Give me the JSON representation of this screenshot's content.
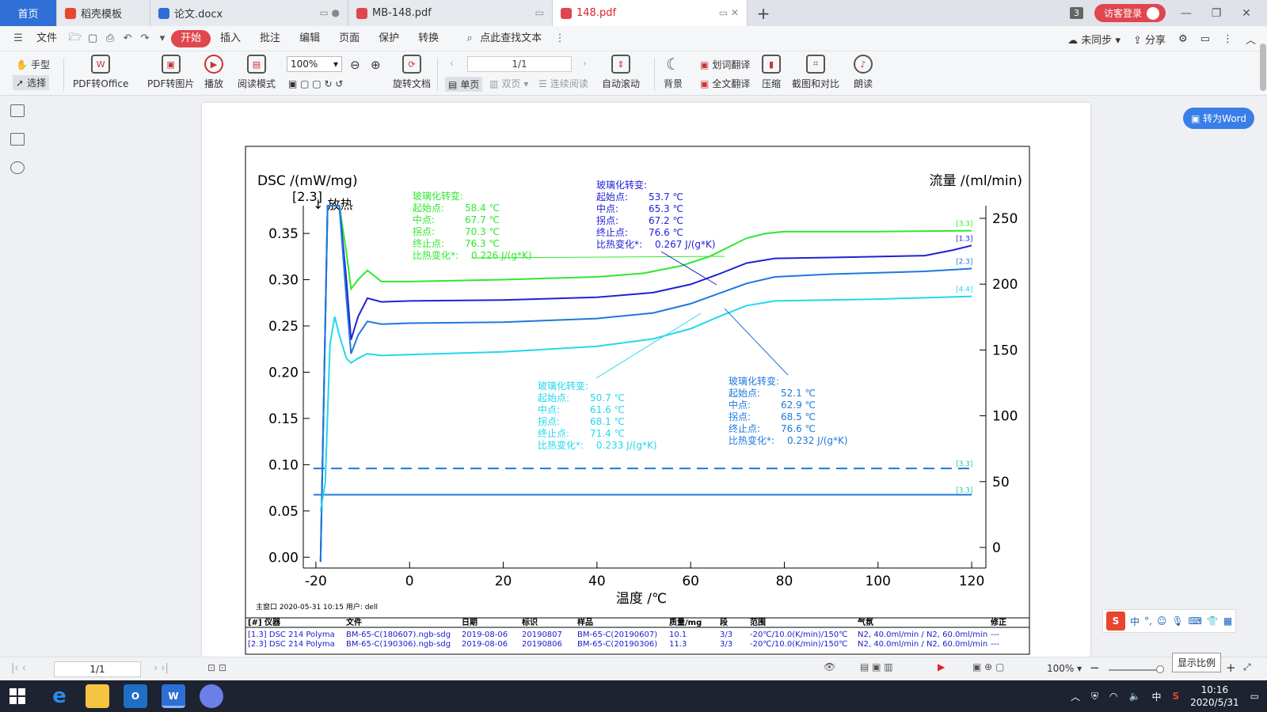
{
  "tabs": [
    {
      "label": "首页",
      "kind": "home"
    },
    {
      "label": "稻壳模板",
      "kind": "docer"
    },
    {
      "label": "论文.docx",
      "kind": "word"
    },
    {
      "label": "MB-148.pdf",
      "kind": "pdf"
    },
    {
      "label": "148.pdf",
      "kind": "pdf",
      "active": true
    }
  ],
  "tab_count": "3",
  "login_label": "访客登录",
  "menu": {
    "file": "文件",
    "items": [
      "开始",
      "插入",
      "批注",
      "编辑",
      "页面",
      "保护",
      "转换"
    ],
    "search_label": "点此查找文本",
    "sync": "未同步",
    "share": "分享"
  },
  "ribbon": {
    "hand": "手型",
    "select": "选择",
    "pdf_to_office": "PDF转Office",
    "pdf_to_image": "PDF转图片",
    "play": "播放",
    "read_mode": "阅读模式",
    "zoom": "100%",
    "rotate": "旋转文档",
    "page_indicator": "1/1",
    "single": "单页",
    "double": "双页",
    "continuous": "连续阅读",
    "autoscroll": "自动滚动",
    "background": "背景",
    "word_translate": "划词翻译",
    "full_translate": "全文翻译",
    "compress": "压缩",
    "screenshot_compare": "截图和对比",
    "read_aloud": "朗读"
  },
  "to_word": "转为Word",
  "status": {
    "page": "1/1",
    "zoom": "100%",
    "tooltip": "显示比例"
  },
  "ime": {
    "lang": "中"
  },
  "taskbar": {
    "time": "10:16",
    "date": "2020/5/31",
    "ime_lang": "中"
  },
  "chart_data": {
    "type": "line",
    "xlabel": "温度 /℃",
    "ylabel_left": "DSC /(mW/mg)",
    "ylabel_right": "流量 /(ml/min)",
    "direction_label_bracket": "[2.3]",
    "direction_label": "↓ 放热",
    "xlim": [
      -21,
      121
    ],
    "ylim_left": [
      -0.01,
      0.38
    ],
    "ylim_right": [
      0,
      262
    ],
    "x_ticks": [
      -20,
      0,
      20,
      40,
      60,
      80,
      100,
      120
    ],
    "y_ticks_left": [
      "0.00",
      "0.05",
      "0.10",
      "0.15",
      "0.20",
      "0.25",
      "0.30",
      "0.35"
    ],
    "y_ticks_right": [
      0,
      50,
      100,
      150,
      200,
      250
    ],
    "series": [
      {
        "name": "[3.3]",
        "color": "#2ee82e",
        "points": [
          [
            -19,
            -0.005
          ],
          [
            -17.5,
            0.38
          ],
          [
            -15,
            0.38
          ],
          [
            -13.5,
            0.33
          ],
          [
            -12.5,
            0.29
          ],
          [
            -11,
            0.3
          ],
          [
            -9,
            0.31
          ],
          [
            -6,
            0.298
          ],
          [
            0,
            0.298
          ],
          [
            20,
            0.3
          ],
          [
            40,
            0.303
          ],
          [
            50,
            0.307
          ],
          [
            58,
            0.315
          ],
          [
            64,
            0.325
          ],
          [
            68,
            0.335
          ],
          [
            72,
            0.345
          ],
          [
            76,
            0.35
          ],
          [
            80,
            0.352
          ],
          [
            100,
            0.352
          ],
          [
            120,
            0.353
          ]
        ]
      },
      {
        "name": "[1.3]",
        "color": "#2020d8",
        "points": [
          [
            -19,
            -0.005
          ],
          [
            -17.5,
            0.38
          ],
          [
            -15,
            0.38
          ],
          [
            -13.5,
            0.3
          ],
          [
            -12.5,
            0.235
          ],
          [
            -11,
            0.26
          ],
          [
            -9,
            0.28
          ],
          [
            -6,
            0.276
          ],
          [
            0,
            0.277
          ],
          [
            20,
            0.278
          ],
          [
            40,
            0.281
          ],
          [
            52,
            0.286
          ],
          [
            60,
            0.295
          ],
          [
            66,
            0.306
          ],
          [
            72,
            0.318
          ],
          [
            78,
            0.323
          ],
          [
            90,
            0.324
          ],
          [
            110,
            0.326
          ],
          [
            116,
            0.332
          ],
          [
            120,
            0.337
          ]
        ]
      },
      {
        "name": "[2.3]",
        "color": "#1e78dc",
        "points": [
          [
            -19,
            -0.005
          ],
          [
            -17.5,
            0.38
          ],
          [
            -15,
            0.38
          ],
          [
            -13.5,
            0.28
          ],
          [
            -12.5,
            0.22
          ],
          [
            -11,
            0.24
          ],
          [
            -9,
            0.255
          ],
          [
            -6,
            0.252
          ],
          [
            0,
            0.253
          ],
          [
            20,
            0.254
          ],
          [
            40,
            0.258
          ],
          [
            52,
            0.264
          ],
          [
            60,
            0.274
          ],
          [
            66,
            0.285
          ],
          [
            72,
            0.296
          ],
          [
            78,
            0.303
          ],
          [
            90,
            0.306
          ],
          [
            110,
            0.309
          ],
          [
            120,
            0.312
          ]
        ]
      },
      {
        "name": "[4.4]",
        "color": "#22d8ec",
        "points": [
          [
            -19,
            0.05
          ],
          [
            -18,
            0.08
          ],
          [
            -17,
            0.23
          ],
          [
            -16,
            0.26
          ],
          [
            -15,
            0.24
          ],
          [
            -13.5,
            0.215
          ],
          [
            -12.5,
            0.21
          ],
          [
            -11,
            0.215
          ],
          [
            -9,
            0.22
          ],
          [
            -6,
            0.218
          ],
          [
            0,
            0.219
          ],
          [
            20,
            0.222
          ],
          [
            40,
            0.228
          ],
          [
            52,
            0.236
          ],
          [
            60,
            0.247
          ],
          [
            66,
            0.26
          ],
          [
            72,
            0.272
          ],
          [
            78,
            0.277
          ],
          [
            100,
            0.279
          ],
          [
            120,
            0.282
          ]
        ]
      }
    ],
    "flow_lines": [
      {
        "name": "[3.3]",
        "y": 60,
        "style": "dashed",
        "color": "#1e78dc"
      },
      {
        "name": "[3.3]",
        "y": 40,
        "style": "solid",
        "color": "#1e78dc"
      }
    ],
    "annotations": [
      {
        "color": "#2ee82e",
        "title": "玻璃化转变:",
        "rows": [
          [
            "起始点:",
            "58.4 ℃"
          ],
          [
            "中点:",
            "67.7 ℃"
          ],
          [
            "拐点:",
            "70.3 ℃"
          ],
          [
            "终止点:",
            "76.3 ℃"
          ],
          [
            "比热变化*:",
            "0.226 J/(g*K)"
          ]
        ]
      },
      {
        "color": "#2020d8",
        "title": "玻璃化转变:",
        "rows": [
          [
            "起始点:",
            "53.7 ℃"
          ],
          [
            "中点:",
            "65.3 ℃"
          ],
          [
            "拐点:",
            "67.2 ℃"
          ],
          [
            "终止点:",
            "76.6 ℃"
          ],
          [
            "比热变化*:",
            "0.267 J/(g*K)"
          ]
        ]
      },
      {
        "color": "#22d8ec",
        "title": "玻璃化转变:",
        "rows": [
          [
            "起始点:",
            "50.7 ℃"
          ],
          [
            "中点:",
            "61.6 ℃"
          ],
          [
            "拐点:",
            "68.1 ℃"
          ],
          [
            "终止点:",
            "71.4 ℃"
          ],
          [
            "比热变化*:",
            "0.233 J/(g*K)"
          ]
        ]
      },
      {
        "color": "#1e78dc",
        "title": "玻璃化转变:",
        "rows": [
          [
            "起始点:",
            "52.1 ℃"
          ],
          [
            "中点:",
            "62.9 ℃"
          ],
          [
            "拐点:",
            "68.5 ℃"
          ],
          [
            "终止点:",
            "76.6 ℃"
          ],
          [
            "比热变化*:",
            "0.232 J/(g*K)"
          ]
        ]
      }
    ],
    "footer": "主窗口    2020-05-31 10:15    用户: dell",
    "table": {
      "headers": [
        "[#] 仪器",
        "文件",
        "日期",
        "标识",
        "样品",
        "质量/mg",
        "段",
        "范围",
        "气氛",
        "修正"
      ],
      "rows": [
        [
          "[1.3] DSC 214 Polyma",
          "BM-65-C(180607).ngb-sdg",
          "2019-08-06",
          "20190807",
          "BM-65-C(20190607)",
          "10.1",
          "3/3",
          "-20℃/10.0(K/min)/150℃",
          "N2, 40.0ml/min / N2, 60.0ml/min",
          "---"
        ],
        [
          "[2.3] DSC 214 Polyma",
          "BM-65-C(190306).ngb-sdg",
          "2019-08-06",
          "20190806",
          "BM-65-C(20190306)",
          "11.3",
          "3/3",
          "-20℃/10.0(K/min)/150℃",
          "N2, 40.0ml/min / N2, 60.0ml/min",
          "---"
        ]
      ]
    }
  }
}
